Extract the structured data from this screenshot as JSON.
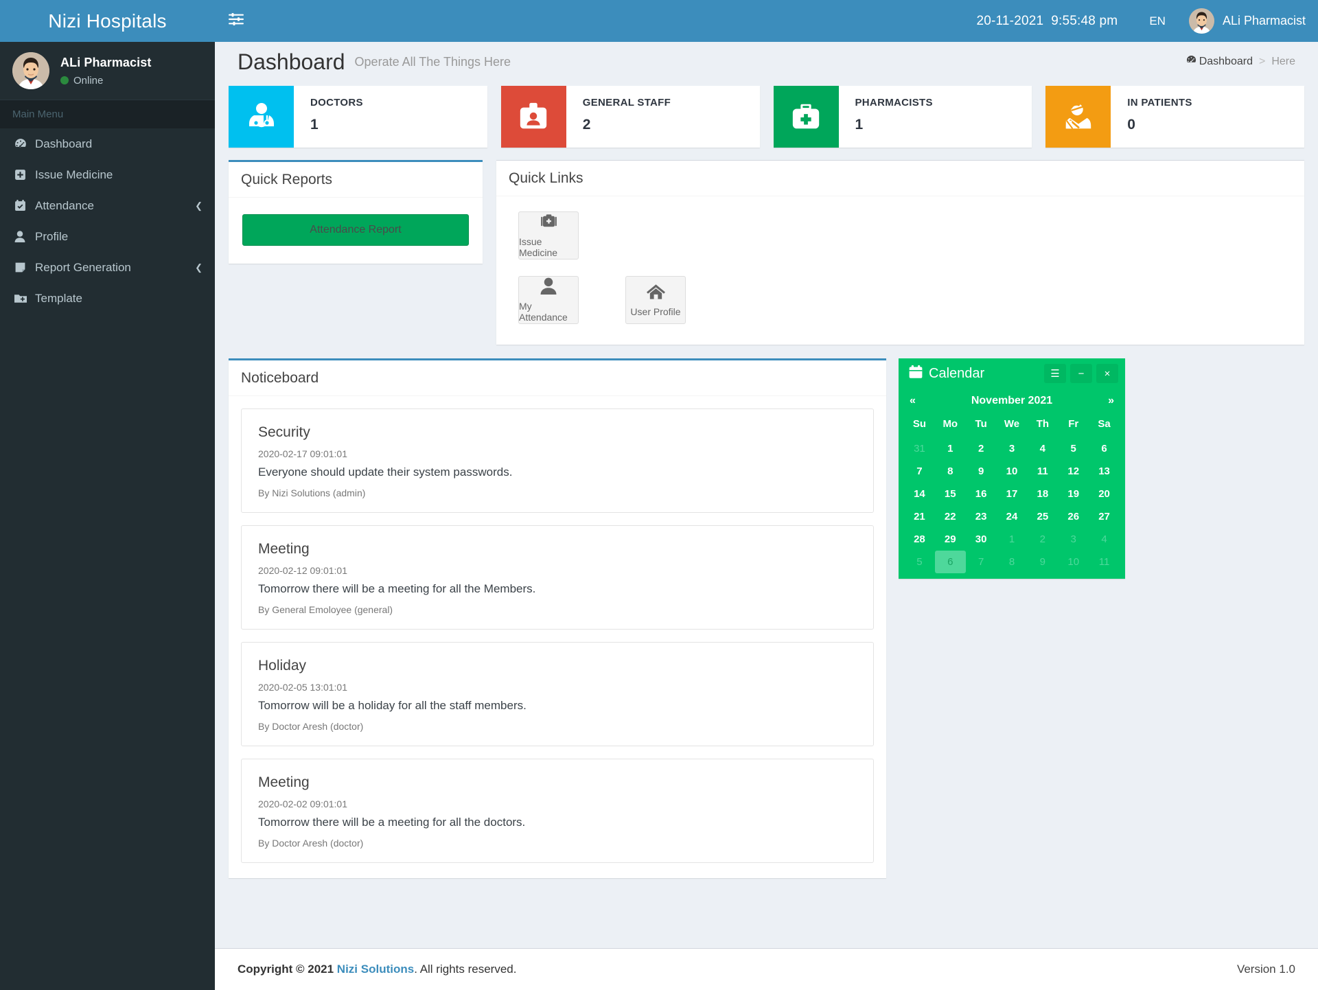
{
  "brand": {
    "name": "Nizi Hospitals"
  },
  "user_panel": {
    "name": "ALi Pharmacist",
    "status": "Online"
  },
  "sidebar": {
    "menu_header": "Main Menu",
    "items": [
      {
        "label": "Dashboard",
        "icon": "dashboard-icon",
        "arrow": ""
      },
      {
        "label": "Issue Medicine",
        "icon": "plus-square-icon",
        "arrow": ""
      },
      {
        "label": "Attendance",
        "icon": "calendar-check-icon",
        "arrow": "❮"
      },
      {
        "label": "Profile",
        "icon": "user-icon",
        "arrow": ""
      },
      {
        "label": "Report Generation",
        "icon": "file-icon",
        "arrow": "❮"
      },
      {
        "label": "Template",
        "icon": "folder-plus-icon",
        "arrow": ""
      }
    ]
  },
  "topbar": {
    "date": "20-11-2021",
    "time": "9:55:48 pm",
    "language": "EN",
    "username": "ALi Pharmacist"
  },
  "page": {
    "title": "Dashboard",
    "subtitle": "Operate All The Things Here",
    "breadcrumb_home": "Dashboard",
    "breadcrumb_sep": ">",
    "breadcrumb_current": "Here"
  },
  "stats": [
    {
      "label": "DOCTORS",
      "value": "1",
      "color": "#00c0ef",
      "icon": "doctor-icon"
    },
    {
      "label": "GENERAL STAFF",
      "value": "2",
      "color": "#dd4b39",
      "icon": "id-badge-icon"
    },
    {
      "label": "PHARMACISTS",
      "value": "1",
      "color": "#00a65a",
      "icon": "medkit-icon"
    },
    {
      "label": "IN PATIENTS",
      "value": "0",
      "color": "#f39c12",
      "icon": "injured-patient-icon"
    }
  ],
  "quick_reports": {
    "title": "Quick Reports",
    "attendance_button": "Attendance Report"
  },
  "quick_links": {
    "title": "Quick Links",
    "items": [
      {
        "label": "Issue Medicine",
        "icon": "medkit-icon"
      },
      {
        "label": "My Attendance",
        "icon": "user-icon"
      },
      {
        "label": "User Profile",
        "icon": "home-icon"
      }
    ]
  },
  "noticeboard": {
    "title": "Noticeboard",
    "notices": [
      {
        "title": "Security",
        "date": "2020-02-17 09:01:01",
        "text": "Everyone should update their system passwords.",
        "by": "By Nizi Solutions (admin)"
      },
      {
        "title": "Meeting",
        "date": "2020-02-12 09:01:01",
        "text": "Tomorrow there will be a meeting for all the Members.",
        "by": "By General Emoloyee (general)"
      },
      {
        "title": "Holiday",
        "date": "2020-02-05 13:01:01",
        "text": "Tomorrow will be a holiday for all the staff members.",
        "by": "By Doctor Aresh (doctor)"
      },
      {
        "title": "Meeting",
        "date": "2020-02-02 09:01:01",
        "text": "Tomorrow there will be a meeting for all the doctors.",
        "by": "By Doctor Aresh (doctor)"
      }
    ]
  },
  "calendar": {
    "title": "Calendar",
    "accent": "#00c66b",
    "tools": {
      "menu": "☰",
      "minimize": "−",
      "close": "×"
    },
    "prev": "«",
    "next": "»",
    "month_label": "November 2021",
    "weekdays": [
      "Su",
      "Mo",
      "Tu",
      "We",
      "Th",
      "Fr",
      "Sa"
    ],
    "weeks": [
      [
        {
          "d": "31",
          "m": true
        },
        {
          "d": "1"
        },
        {
          "d": "2"
        },
        {
          "d": "3"
        },
        {
          "d": "4"
        },
        {
          "d": "5"
        },
        {
          "d": "6"
        }
      ],
      [
        {
          "d": "7"
        },
        {
          "d": "8"
        },
        {
          "d": "9"
        },
        {
          "d": "10"
        },
        {
          "d": "11"
        },
        {
          "d": "12"
        },
        {
          "d": "13"
        }
      ],
      [
        {
          "d": "14"
        },
        {
          "d": "15"
        },
        {
          "d": "16"
        },
        {
          "d": "17"
        },
        {
          "d": "18"
        },
        {
          "d": "19"
        },
        {
          "d": "20"
        }
      ],
      [
        {
          "d": "21"
        },
        {
          "d": "22"
        },
        {
          "d": "23"
        },
        {
          "d": "24"
        },
        {
          "d": "25"
        },
        {
          "d": "26"
        },
        {
          "d": "27"
        }
      ],
      [
        {
          "d": "28"
        },
        {
          "d": "29"
        },
        {
          "d": "30"
        },
        {
          "d": "1",
          "m": true
        },
        {
          "d": "2",
          "m": true
        },
        {
          "d": "3",
          "m": true
        },
        {
          "d": "4",
          "m": true
        }
      ],
      [
        {
          "d": "5",
          "m": true
        },
        {
          "d": "6",
          "m": true,
          "today": true
        },
        {
          "d": "7",
          "m": true
        },
        {
          "d": "8",
          "m": true
        },
        {
          "d": "9",
          "m": true
        },
        {
          "d": "10",
          "m": true
        },
        {
          "d": "11",
          "m": true
        }
      ]
    ]
  },
  "footer": {
    "copyright_prefix": "Copyright © 2021",
    "brand_link": "Nizi Solutions",
    "copyright_suffix": ". All rights reserved.",
    "version": "Version 1.0"
  }
}
